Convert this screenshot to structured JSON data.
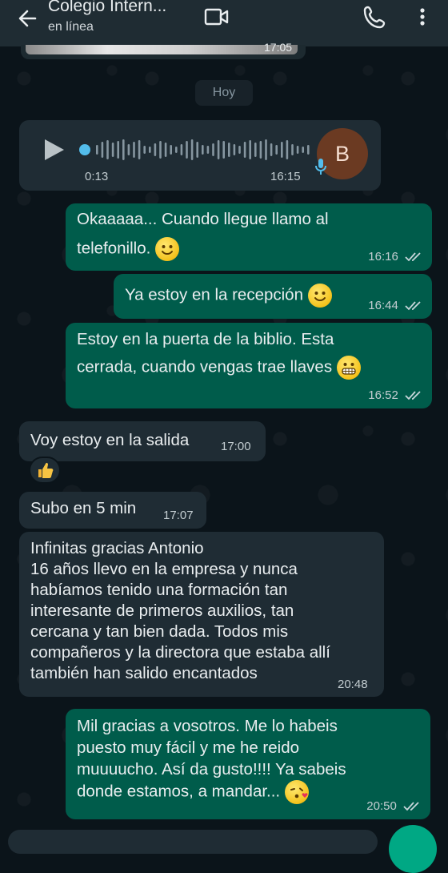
{
  "header": {
    "title": "Colegio Intern...",
    "status": "en línea"
  },
  "previous": {
    "time": "17:05"
  },
  "date_chip": "Hoy",
  "voice_note": {
    "duration": "0:13",
    "time": "16:15",
    "avatar_letter": "B"
  },
  "messages": [
    {
      "direction": "out",
      "text": "Okaaaaa... Cuando llegue llamo al",
      "text2": "telefonillo.",
      "emoji": "slightly-smiling-face",
      "time": "16:16"
    },
    {
      "direction": "out",
      "text": "Ya estoy en la recepción",
      "emoji": "slightly-smiling-face",
      "time": "16:44"
    },
    {
      "direction": "out",
      "text": "Estoy en la puerta de la biblio. Esta",
      "text2": "cerrada, cuando vengas trae llaves",
      "emoji": "grimacing-face",
      "time": "16:52"
    },
    {
      "direction": "in",
      "text": "Voy estoy en la salida",
      "time": "17:00",
      "reaction": "thumbs-up"
    },
    {
      "direction": "in",
      "text": "Subo en 5 min",
      "time": "17:07"
    },
    {
      "direction": "in",
      "lines": [
        "Infinitas gracias Antonio",
        "16 años llevo en la empresa y nunca",
        "habíamos tenido una formación tan",
        "interesante de primeros auxilios, tan",
        "cercana y tan bien dada. Todos mis",
        "compañeros y la directora que estaba allí",
        "también han salido encantados"
      ],
      "time": "20:48"
    },
    {
      "direction": "out",
      "lines": [
        "Mil gracias a vosotros. Me lo habeis",
        "puesto muy fácil y me he reido",
        "muuuucho. Así da gusto!!!! Ya sabeis",
        "donde estamos, a mandar..."
      ],
      "emoji": "face-blowing-kiss",
      "time": "20:50"
    }
  ],
  "colors": {
    "incoming": "#1f2c34",
    "outgoing": "#005c4b",
    "background": "#0b141a",
    "read_ticks": "#8fb4c2",
    "accent": "#00a884"
  }
}
